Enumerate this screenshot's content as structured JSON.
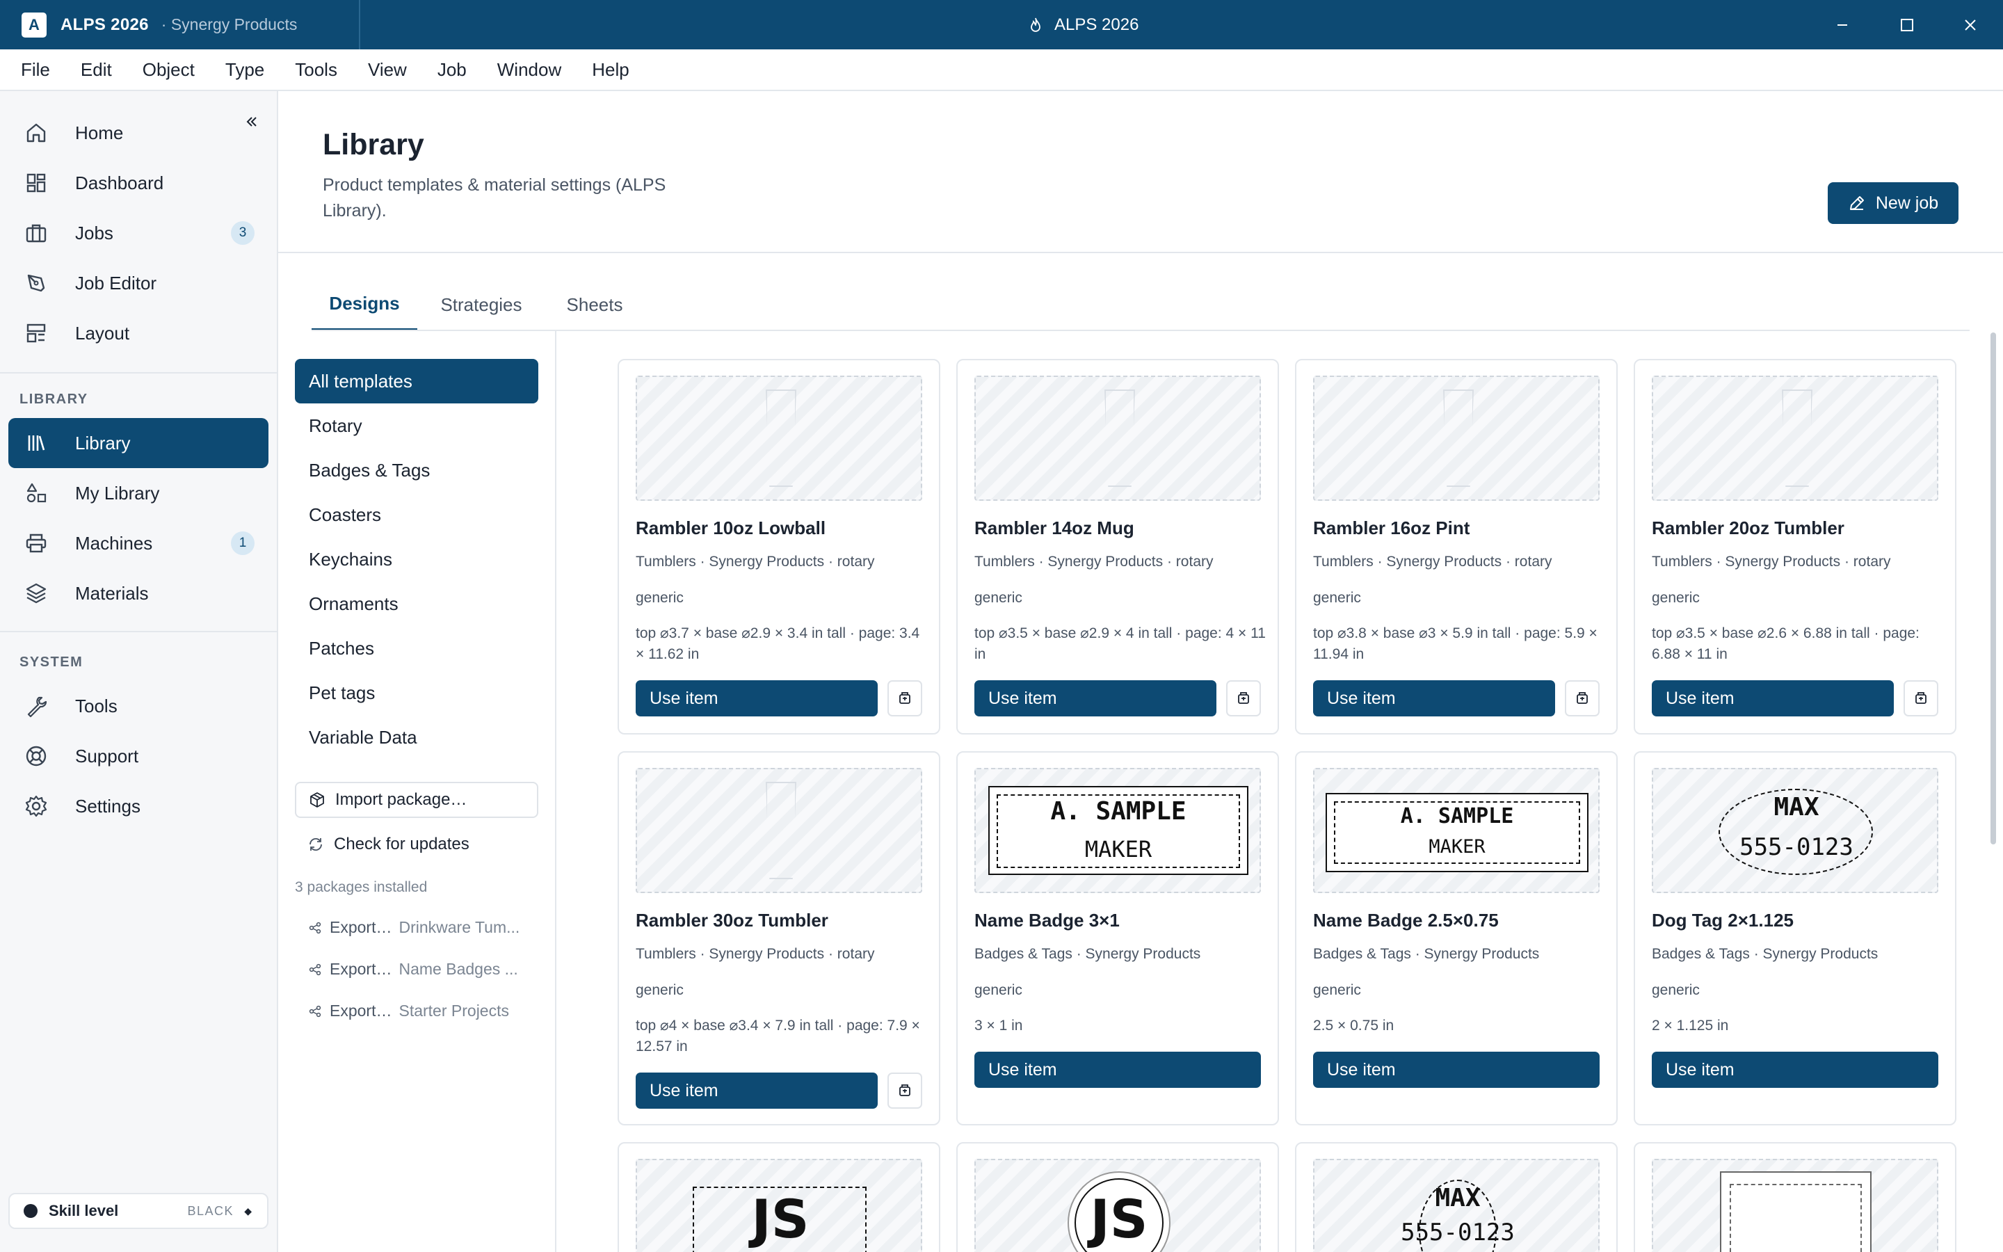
{
  "window": {
    "app_name": "ALPS 2026",
    "app_logo_letter": "A",
    "workspace": "· Synergy Products",
    "center_title": "ALPS 2026"
  },
  "menu": [
    "File",
    "Edit",
    "Object",
    "Type",
    "Tools",
    "View",
    "Job",
    "Window",
    "Help"
  ],
  "sidebar": {
    "nav": [
      {
        "label": "Home",
        "icon": "home-icon"
      },
      {
        "label": "Dashboard",
        "icon": "dashboard-icon"
      },
      {
        "label": "Jobs",
        "icon": "briefcase-icon",
        "badge": "3"
      },
      {
        "label": "Job Editor",
        "icon": "pen-tool-icon"
      },
      {
        "label": "Layout",
        "icon": "layout-icon"
      }
    ],
    "library_label": "LIBRARY",
    "library": [
      {
        "label": "Library",
        "icon": "library-icon",
        "active": true
      },
      {
        "label": "My Library",
        "icon": "shapes-icon"
      },
      {
        "label": "Machines",
        "icon": "printer-icon",
        "badge": "1"
      },
      {
        "label": "Materials",
        "icon": "layers-icon"
      }
    ],
    "system_label": "SYSTEM",
    "system": [
      {
        "label": "Tools",
        "icon": "wrench-icon"
      },
      {
        "label": "Support",
        "icon": "lifebuoy-icon"
      },
      {
        "label": "Settings",
        "icon": "gear-icon"
      }
    ],
    "skill": {
      "label": "Skill level",
      "value": "BLACK"
    }
  },
  "page": {
    "title": "Library",
    "description": "Product templates & material settings (ALPS Library).",
    "new_job_label": "New job"
  },
  "tabs": [
    {
      "label": "Designs",
      "active": true
    },
    {
      "label": "Strategies"
    },
    {
      "label": "Sheets"
    }
  ],
  "categories": [
    "All templates",
    "Rotary",
    "Badges & Tags",
    "Coasters",
    "Keychains",
    "Ornaments",
    "Patches",
    "Pet tags",
    "Variable Data"
  ],
  "packages": {
    "import_label": "Import package…",
    "check_label": "Check for updates",
    "installed_text": "3 packages installed",
    "exports": [
      {
        "label": "Export…",
        "name": "Drinkware Tum..."
      },
      {
        "label": "Export…",
        "name": "Name Badges ..."
      },
      {
        "label": "Export…",
        "name": "Starter Projects"
      }
    ]
  },
  "cards": [
    {
      "title": "Rambler 10oz Lowball",
      "meta": "Tumblers · Synergy Products · rotary",
      "tag": "generic",
      "dims": "top ⌀3.7 × base ⌀2.9 × 3.4 in tall · page: 3.4 × 11.62 in",
      "button": "Use item",
      "thumb": "cup"
    },
    {
      "title": "Rambler 14oz Mug",
      "meta": "Tumblers · Synergy Products · rotary",
      "tag": "generic",
      "dims": "top ⌀3.5 × base ⌀2.9 × 4 in tall · page: 4 × 11 in",
      "button": "Use item",
      "thumb": "cup"
    },
    {
      "title": "Rambler 16oz Pint",
      "meta": "Tumblers · Synergy Products · rotary",
      "tag": "generic",
      "dims": "top ⌀3.8 × base ⌀3 × 5.9 in tall · page: 5.9 × 11.94 in",
      "button": "Use item",
      "thumb": "cup"
    },
    {
      "title": "Rambler 20oz Tumbler",
      "meta": "Tumblers · Synergy Products · rotary",
      "tag": "generic",
      "dims": "top ⌀3.5 × base ⌀2.6 × 6.88 in tall · page: 6.88 × 11 in",
      "button": "Use item",
      "thumb": "cup"
    },
    {
      "title": "Rambler 30oz Tumbler",
      "meta": "Tumblers · Synergy Products · rotary",
      "tag": "generic",
      "dims": "top ⌀4 × base ⌀3.4 × 7.9 in tall · page: 7.9 × 12.57 in",
      "button": "Use item",
      "thumb": "cup"
    },
    {
      "title": "Name Badge 3×1",
      "meta": "Badges & Tags · Synergy Products",
      "tag": "generic",
      "dims": "3 × 1 in",
      "button": "Use item",
      "thumb": "badge",
      "art": [
        "A. SAMPLE",
        "MAKER"
      ]
    },
    {
      "title": "Name Badge 2.5×0.75",
      "meta": "Badges & Tags · Synergy Products",
      "tag": "generic",
      "dims": "2.5 × 0.75 in",
      "button": "Use item",
      "thumb": "badge",
      "art": [
        "A. SAMPLE",
        "MAKER"
      ]
    },
    {
      "title": "Dog Tag 2×1.125",
      "meta": "Badges & Tags · Synergy Products",
      "tag": "generic",
      "dims": "2 × 1.125 in",
      "button": "Use item",
      "thumb": "dogtag",
      "art": [
        "MAX",
        "555-0123"
      ]
    }
  ],
  "partial_cards": [
    {
      "art": "JS"
    },
    {
      "art": "JS"
    },
    {
      "art": [
        "MAX",
        "555-0123"
      ]
    },
    {
      "art": ""
    }
  ]
}
